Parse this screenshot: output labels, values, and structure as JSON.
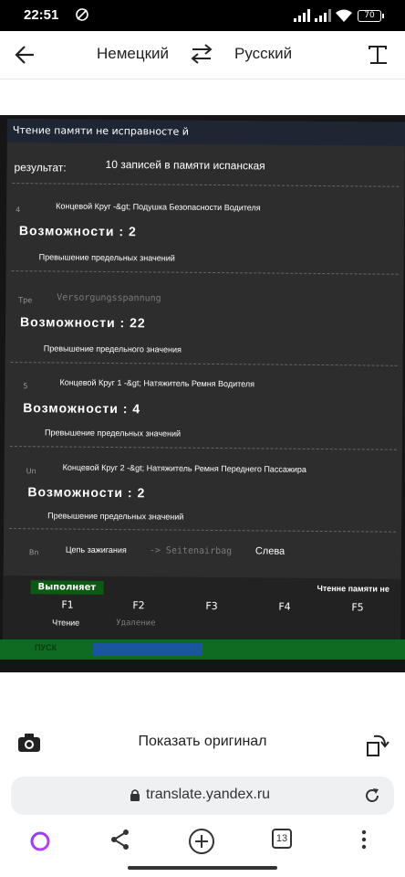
{
  "status_bar": {
    "time": "22:51",
    "battery": "70"
  },
  "toolbar": {
    "source_lang": "Немецкий",
    "target_lang": "Русский"
  },
  "photo": {
    "header": "Чтение памяти не исправносте й",
    "result_label": "результат:",
    "result_value": "10 записей в памяти испанская",
    "entries": [
      {
        "num": "4",
        "title": "Концевой Круг -&gt; Подушка Безопасности Водителя",
        "possibilities": "Возможности : 2",
        "note": "Превышение предельных значений"
      },
      {
        "num": "Tpe",
        "title": "Versorgungsspannung",
        "possibilities": "Возможности : 22",
        "note": "Превышение предельного значения"
      },
      {
        "num": "5",
        "title": "Концевой Круг 1 -&gt; Натяжитель Ремня Водителя",
        "possibilities": "Возможности : 4",
        "note": "Превышение предельных значений"
      },
      {
        "num": "Un",
        "title": "Концевой Круг 2 -&gt; Натяжитель Ремня Переднего Пассажира",
        "possibilities": "Возможности : 2",
        "note": "Превышение предельных значений"
      }
    ],
    "last_entry": {
      "num": "Bn",
      "label": "Цепь зажигания",
      "mid": "-> Seitenairbag",
      "tail": "Слева"
    },
    "run_button": "Выполняет",
    "memory_label": "Чтенне памяти не",
    "fkeys": [
      "F1",
      "F2",
      "F3",
      "F4",
      "F5"
    ],
    "f1_sub": "Чтение",
    "f2_sub": "Удаление",
    "bottom_label": "ПУСК"
  },
  "actions": {
    "show_original": "Показать оригинал"
  },
  "browser": {
    "url": "translate.yandex.ru",
    "tab_count": "13"
  }
}
